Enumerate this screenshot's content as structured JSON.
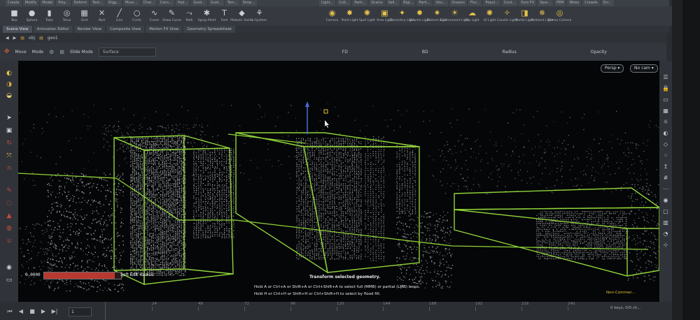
{
  "shelf_tabs_left": [
    "Create",
    "Modify",
    "Model",
    "Poly...",
    "Deform",
    "Text...",
    "Rigg...",
    "Musc...",
    "Char...",
    "Cons...",
    "Hair...",
    "Guid...",
    "Guid...",
    "Terr...",
    "Simp..."
  ],
  "shelf_tabs_right": [
    "Light...",
    "Coll...",
    "Parti...",
    "Grains",
    "Vell...",
    "Rigi...",
    "Parti...",
    "Visc...",
    "Oceans",
    "Flui...",
    "Popul...",
    "Cont...",
    "Pyro FX",
    "Spar...",
    "FEM",
    "Wires",
    "Crowds",
    "Dri..."
  ],
  "tools_left": [
    {
      "label": "Box",
      "icon": "box-icon",
      "glyph": "■"
    },
    {
      "label": "Sphere",
      "icon": "sphere-icon",
      "glyph": "●"
    },
    {
      "label": "Tube",
      "icon": "tube-icon",
      "glyph": "▮"
    },
    {
      "label": "Torus",
      "icon": "torus-icon",
      "glyph": "◎"
    },
    {
      "label": "Grid",
      "icon": "grid-icon",
      "glyph": "▦"
    },
    {
      "label": "Null",
      "icon": "null-icon",
      "glyph": "✕"
    },
    {
      "label": "Line",
      "icon": "line-icon",
      "glyph": "╱"
    },
    {
      "label": "Circle",
      "icon": "circle-icon",
      "glyph": "○"
    },
    {
      "label": "Curve",
      "icon": "curve-icon",
      "glyph": "∿"
    },
    {
      "label": "Draw Curve",
      "icon": "draw-curve-icon",
      "glyph": "✎"
    },
    {
      "label": "Path",
      "icon": "path-icon",
      "glyph": "⤳"
    },
    {
      "label": "Spray Paint",
      "icon": "spray-paint-icon",
      "glyph": "✱"
    },
    {
      "label": "Font",
      "icon": "font-icon",
      "glyph": "T"
    },
    {
      "label": "Platonic Solids",
      "icon": "platonic-solids-icon",
      "glyph": "◆"
    },
    {
      "label": "L-System",
      "icon": "l-system-icon",
      "glyph": "⚘"
    }
  ],
  "tools_right": [
    {
      "label": "Camera",
      "icon": "camera-icon",
      "glyph": "◉"
    },
    {
      "label": "Point Light",
      "icon": "point-light-icon",
      "glyph": "✸"
    },
    {
      "label": "Spot Light",
      "icon": "spot-light-icon",
      "glyph": "✺"
    },
    {
      "label": "Area Light",
      "icon": "area-light-icon",
      "glyph": "▣"
    },
    {
      "label": "Geometry Light",
      "icon": "geometry-light-icon",
      "glyph": "✦"
    },
    {
      "label": "Volume Light",
      "icon": "volume-light-icon",
      "glyph": "✹"
    },
    {
      "label": "Distant Light",
      "icon": "distant-light-icon",
      "glyph": "✷"
    },
    {
      "label": "Environment Light",
      "icon": "environment-light-icon",
      "glyph": "☀"
    },
    {
      "label": "Sky Light",
      "icon": "sky-light-icon",
      "glyph": "☁"
    },
    {
      "label": "GI Light",
      "icon": "gi-light-icon",
      "glyph": "✺"
    },
    {
      "label": "Caustic Light",
      "icon": "caustic-light-icon",
      "glyph": "✧"
    },
    {
      "label": "Portal Light",
      "icon": "portal-light-icon",
      "glyph": "◨"
    },
    {
      "label": "Ambient Light",
      "icon": "ambient-light-icon",
      "glyph": "✵"
    },
    {
      "label": "Stereo Camera",
      "icon": "stereo-camera-icon",
      "glyph": "◎"
    }
  ],
  "pane_tabs": [
    "Scene View",
    "Animation Editor",
    "Render View",
    "Composite View",
    "Motion FX View",
    "Geometry Spreadsheet"
  ],
  "path": {
    "root": "obj",
    "node": "geo1"
  },
  "op_bar": {
    "tool": "Move",
    "mode": "Mode",
    "slide_mode": "Slide Mode",
    "surface": "Surface",
    "field_fd": "FD",
    "field_bd": "BD",
    "radius_label": "Radius",
    "opacity_label": "Opacity"
  },
  "viewport": {
    "persp": "Persp ▾",
    "camera": "No cam ▾",
    "slider_value": "0.0000",
    "slider_fraction": 0.92,
    "slider_label": "Soft Edit Radius",
    "hint_title": "Transform selected geometry.",
    "hint_line1": "Hold A or Ctrl+A or Shift+A or Ctrl+Shift+A to select full (MMB) or partial (LMB) loops.",
    "hint_line2": "Hold H or Ctrl+H or Shift+H or Ctrl+Shift+H to select by flood fill.",
    "noncommercial": "Non-Commer..."
  },
  "timeline": {
    "frame": "1",
    "ticks": [
      "24",
      "48",
      "72",
      "96",
      "120",
      "144",
      "168",
      "192",
      "216",
      "240"
    ],
    "keys": "0 keys, 0/0 ch..."
  },
  "colors": {
    "bbox": "#8fd43a",
    "slider": "#b8392f",
    "noncommercial": "#e0c23a"
  }
}
